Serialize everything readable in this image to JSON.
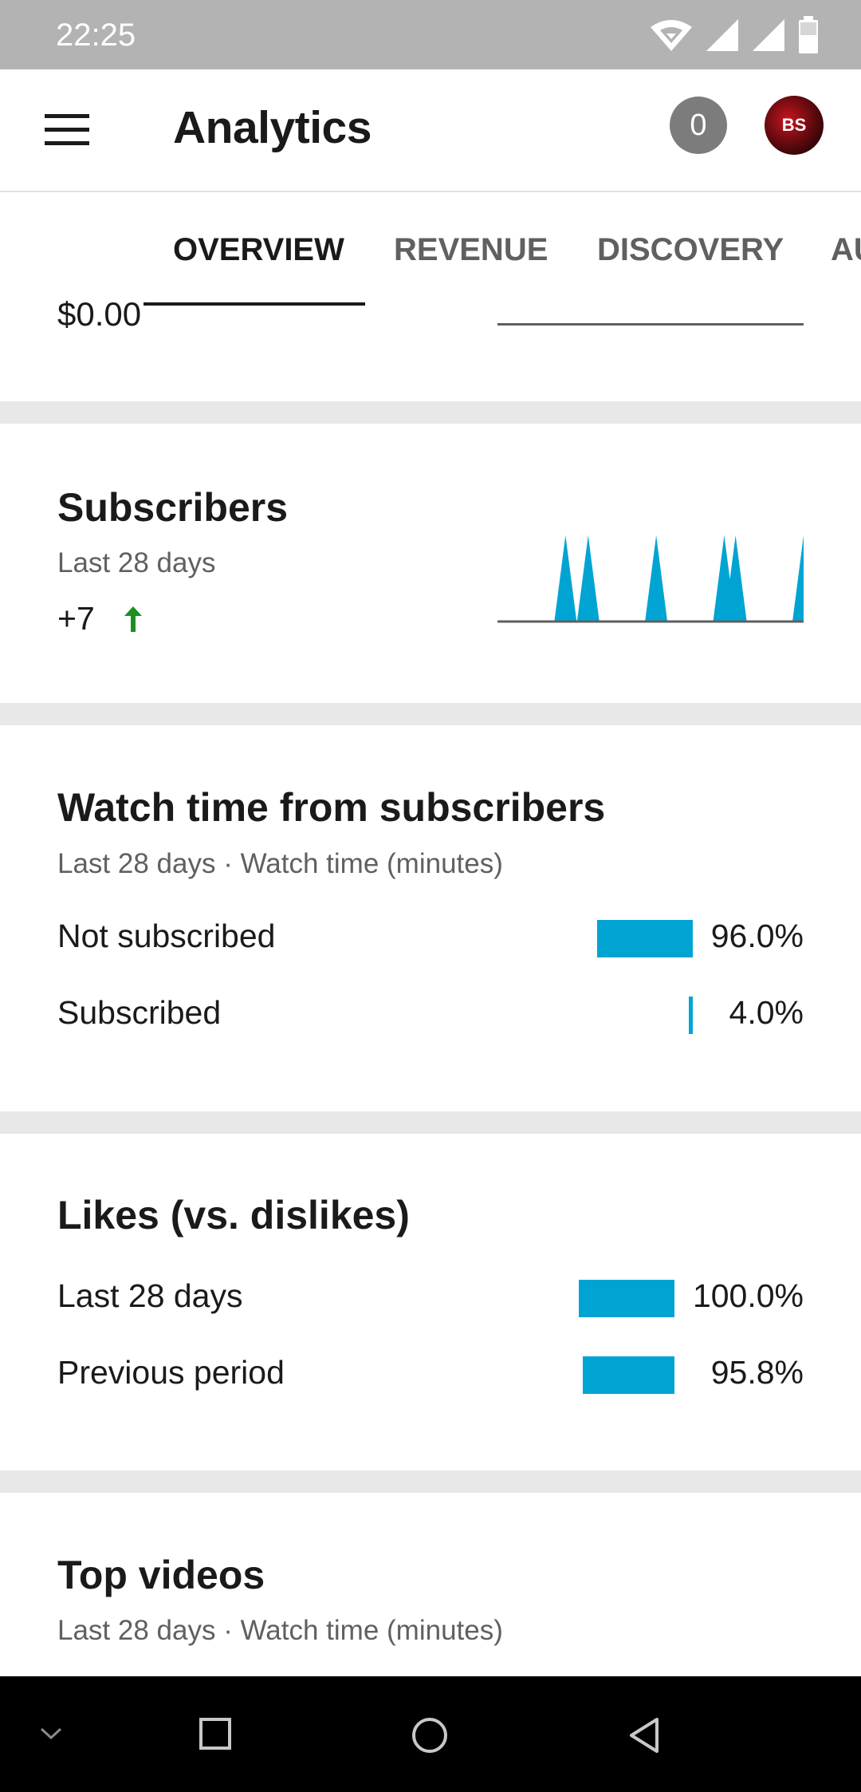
{
  "status_bar": {
    "time": "22:25"
  },
  "app_bar": {
    "title": "Analytics",
    "notification_count": "0",
    "avatar_initials": "BS"
  },
  "tabs": [
    {
      "label": "OVERVIEW",
      "active": true
    },
    {
      "label": "REVENUE",
      "active": false
    },
    {
      "label": "DISCOVERY",
      "active": false
    },
    {
      "label": "AU",
      "active": false
    }
  ],
  "partial_card": {
    "value": "$0.00"
  },
  "subscribers": {
    "title": "Subscribers",
    "period": "Last 28 days",
    "change": "+7",
    "trend": "up",
    "trend_color": "#1e8e1e",
    "chart_data": {
      "type": "area",
      "x": [
        "d1",
        "d2",
        "d3",
        "d4",
        "d5",
        "d6",
        "d7",
        "d8",
        "d9",
        "d10",
        "d11",
        "d12",
        "d13",
        "d14",
        "d15",
        "d16",
        "d17",
        "d18",
        "d19",
        "d20",
        "d21",
        "d22",
        "d23",
        "d24",
        "d25",
        "d26",
        "d27",
        "d28"
      ],
      "values": [
        0,
        0,
        0,
        0,
        0,
        0,
        1,
        0,
        1,
        0,
        0,
        0,
        0,
        0,
        1,
        0,
        0,
        0,
        0,
        0,
        1,
        1,
        0,
        0,
        0,
        0,
        0,
        1
      ],
      "color": "#00a4d3"
    }
  },
  "watch_time": {
    "title": "Watch time from subscribers",
    "subtitle": "Last 28 days · Watch time (minutes)",
    "rows": [
      {
        "label": "Not subscribed",
        "value": "96.0%",
        "fraction": 0.96
      },
      {
        "label": "Subscribed",
        "value": "4.0%",
        "fraction": 0.04
      }
    ]
  },
  "likes": {
    "title": "Likes (vs. dislikes)",
    "rows": [
      {
        "label": "Last 28 days",
        "value": "100.0%",
        "fraction": 1.0
      },
      {
        "label": "Previous period",
        "value": "95.8%",
        "fraction": 0.958
      }
    ]
  },
  "top_videos": {
    "title": "Top videos",
    "subtitle": "Last 28 days · Watch time (minutes)"
  },
  "colors": {
    "accent": "#00a4d3",
    "status_bar": "#b3b3b3",
    "divider": "#e8e8e8"
  }
}
